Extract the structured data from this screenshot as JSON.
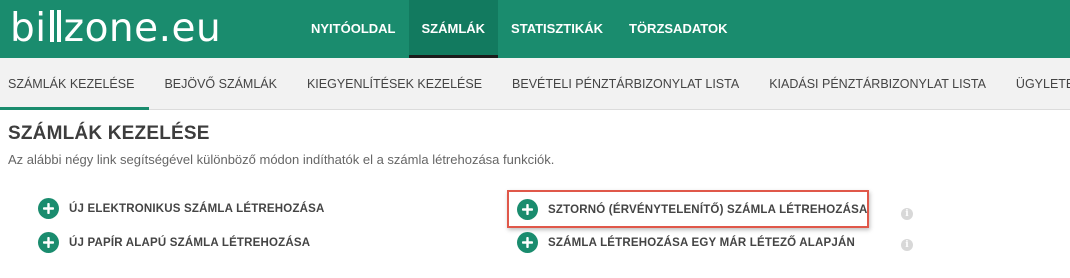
{
  "logo": {
    "left": "bi",
    "right": "zone.eu"
  },
  "main_nav": [
    {
      "label": "NYITÓOLDAL",
      "active": false
    },
    {
      "label": "SZÁMLÁK",
      "active": true
    },
    {
      "label": "STATISZTIKÁK",
      "active": false
    },
    {
      "label": "TÖRZSADATOK",
      "active": false
    }
  ],
  "sub_nav": [
    {
      "label": "SZÁMLÁK KEZELÉSE",
      "active": true
    },
    {
      "label": "BEJÖVŐ SZÁMLÁK",
      "active": false
    },
    {
      "label": "KIEGYENLÍTÉSEK KEZELÉSE",
      "active": false
    },
    {
      "label": "BEVÉTELI PÉNZTÁRBIZONYLAT LISTA",
      "active": false
    },
    {
      "label": "KIADÁSI PÉNZTÁRBIZONYLAT LISTA",
      "active": false
    },
    {
      "label": "ÜGYLETEK",
      "active": false
    }
  ],
  "page": {
    "title": "SZÁMLÁK KEZELÉSE",
    "description": "Az alábbi négy link segítségével különböző módon indíthatók el a számla létrehozása funkciók."
  },
  "actions": {
    "new_electronic": "ÚJ ELEKTRONIKUS SZÁMLA LÉTREHOZÁSA",
    "new_paper": "ÚJ PAPÍR ALAPÚ SZÁMLA LÉTREHOZÁSA",
    "storno": "SZTORNÓ (ÉRVÉNYTELENÍTŐ) SZÁMLA LÉTREHOZÁSA",
    "from_existing": "SZÁMLA LÉTREHOZÁSA EGY MÁR LÉTEZŐ ALAPJÁN"
  },
  "info_icon_glyph": "i",
  "colors": {
    "brand": "#1a8c6e",
    "highlight": "#e0584a"
  }
}
